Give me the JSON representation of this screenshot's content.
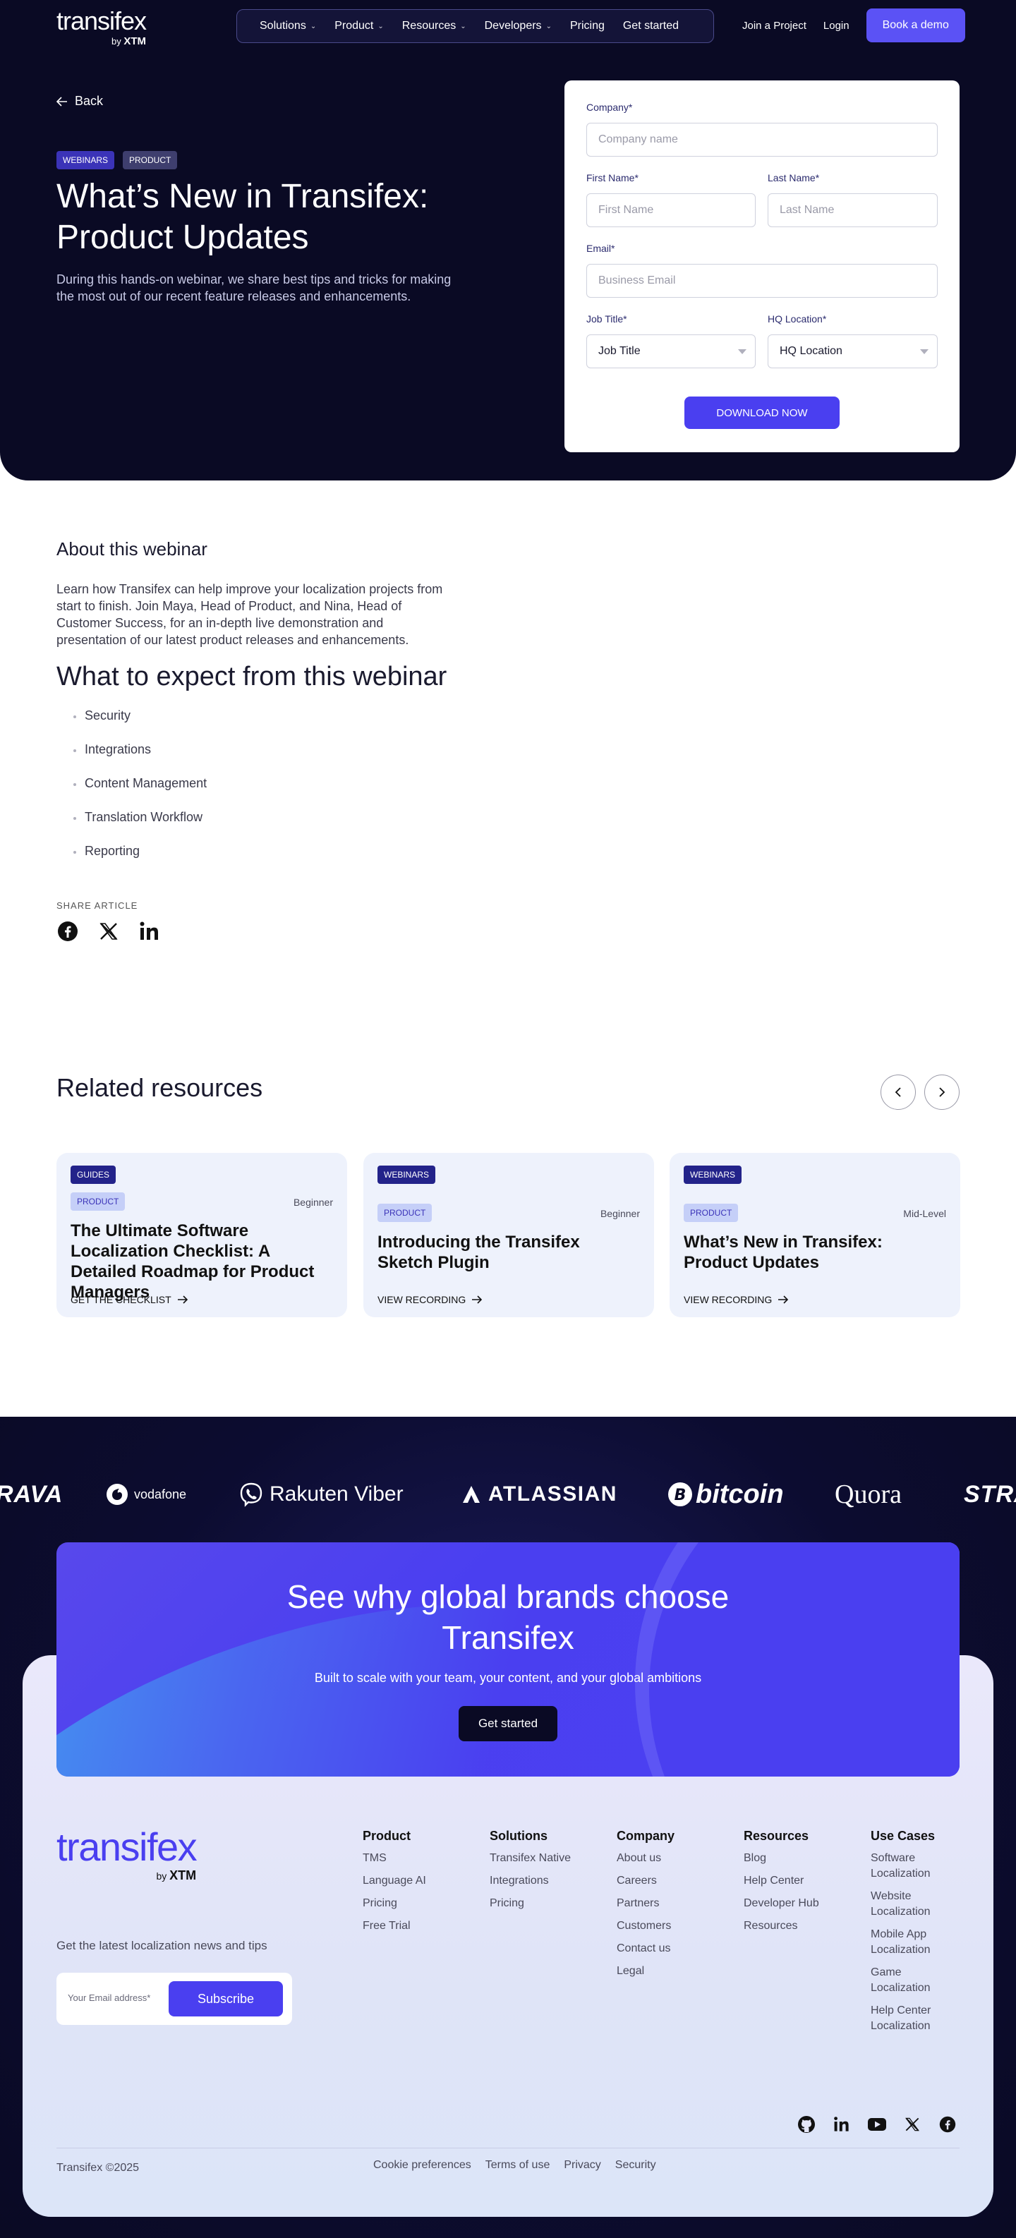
{
  "header": {
    "logo": "transifex",
    "logo_by": "by",
    "logo_xtm": "XTM",
    "nav": [
      {
        "label": "Solutions",
        "dropdown": true
      },
      {
        "label": "Product",
        "dropdown": true
      },
      {
        "label": "Resources",
        "dropdown": true
      },
      {
        "label": "Developers",
        "dropdown": true
      },
      {
        "label": "Pricing",
        "dropdown": false
      },
      {
        "label": "Get started",
        "dropdown": false
      }
    ],
    "join_project": "Join a Project",
    "login": "Login",
    "book_demo": "Book a demo"
  },
  "hero": {
    "back": "Back",
    "tags": [
      "WEBINARS",
      "PRODUCT"
    ],
    "title": "What’s New in Transifex: Product Updates",
    "description": "During this hands-on webinar, we share best tips and tricks for making the most out of our recent feature releases and enhancements."
  },
  "form": {
    "company_label": "Company*",
    "company_placeholder": "Company name",
    "first_name_label": "First Name*",
    "first_name_placeholder": "First Name",
    "last_name_label": "Last Name*",
    "last_name_placeholder": "Last Name",
    "email_label": "Email*",
    "email_placeholder": "Business Email",
    "job_title_label": "Job Title*",
    "job_title_value": "Job Title",
    "hq_label": "HQ Location*",
    "hq_value": "HQ Location",
    "submit": "DOWNLOAD NOW"
  },
  "about": {
    "heading": "About this webinar",
    "text": "Learn how Transifex can help improve your localization projects from start to finish. Join Maya, Head of Product, and Nina, Head of Customer Success, for an in-depth live demonstration and presentation of our latest product releases and enhancements.",
    "expect_heading": "What to expect from this webinar",
    "expect_items": [
      "Security",
      "Integrations",
      "Content Management",
      "Translation Workflow",
      "Reporting"
    ],
    "share_label": "SHARE ARTICLE"
  },
  "related": {
    "heading": "Related resources",
    "cards": [
      {
        "tag1": "GUIDES",
        "tag2": "PRODUCT",
        "level": "Beginner",
        "title": "The Ultimate Software Localization Checklist: A Detailed Roadmap for Product Managers",
        "cta": "GET THE CHECKLIST"
      },
      {
        "tag1": "WEBINARS",
        "tag2": "PRODUCT",
        "level": "Beginner",
        "title": "Introducing the Transifex Sketch Plugin",
        "cta": "VIEW RECORDING"
      },
      {
        "tag1": "WEBINARS",
        "tag2": "PRODUCT",
        "level": "Mid-Level",
        "title": "What’s New in Transifex: Product Updates",
        "cta": "VIEW RECORDING"
      }
    ]
  },
  "brands": [
    "RAVA",
    "vodafone",
    "Rakuten Viber",
    "ATLASSIAN",
    "bitcoin",
    "Quora",
    "STRA"
  ],
  "cta": {
    "title": "See why global brands choose Transifex",
    "subtitle": "Built to scale with your team, your content, and your global ambitions",
    "button": "Get started"
  },
  "footer": {
    "logo": "transifex",
    "logo_by": "by",
    "logo_xtm": "XTM",
    "newsletter": "Get the latest localization news and tips",
    "email_placeholder": "Your Email address*",
    "subscribe": "Subscribe",
    "columns": [
      {
        "title": "Product",
        "links": [
          "TMS",
          "Language AI",
          "Pricing",
          "Free Trial"
        ]
      },
      {
        "title": "Solutions",
        "links": [
          "Transifex Native",
          "Integrations",
          "Pricing"
        ]
      },
      {
        "title": "Company",
        "links": [
          "About us",
          "Careers",
          "Partners",
          "Customers",
          "Contact us",
          "Legal"
        ]
      },
      {
        "title": "Resources",
        "links": [
          "Blog",
          "Help Center",
          "Developer Hub",
          "Resources"
        ]
      },
      {
        "title": "Use Cases",
        "links": [
          "Software Localization",
          "Website Localization",
          "Mobile App Localization",
          "Game Localization",
          "Help Center Localization"
        ]
      }
    ],
    "copyright": "Transifex ©2025",
    "legal_links": [
      "Cookie preferences",
      "Terms of use",
      "Privacy",
      "Security"
    ]
  }
}
